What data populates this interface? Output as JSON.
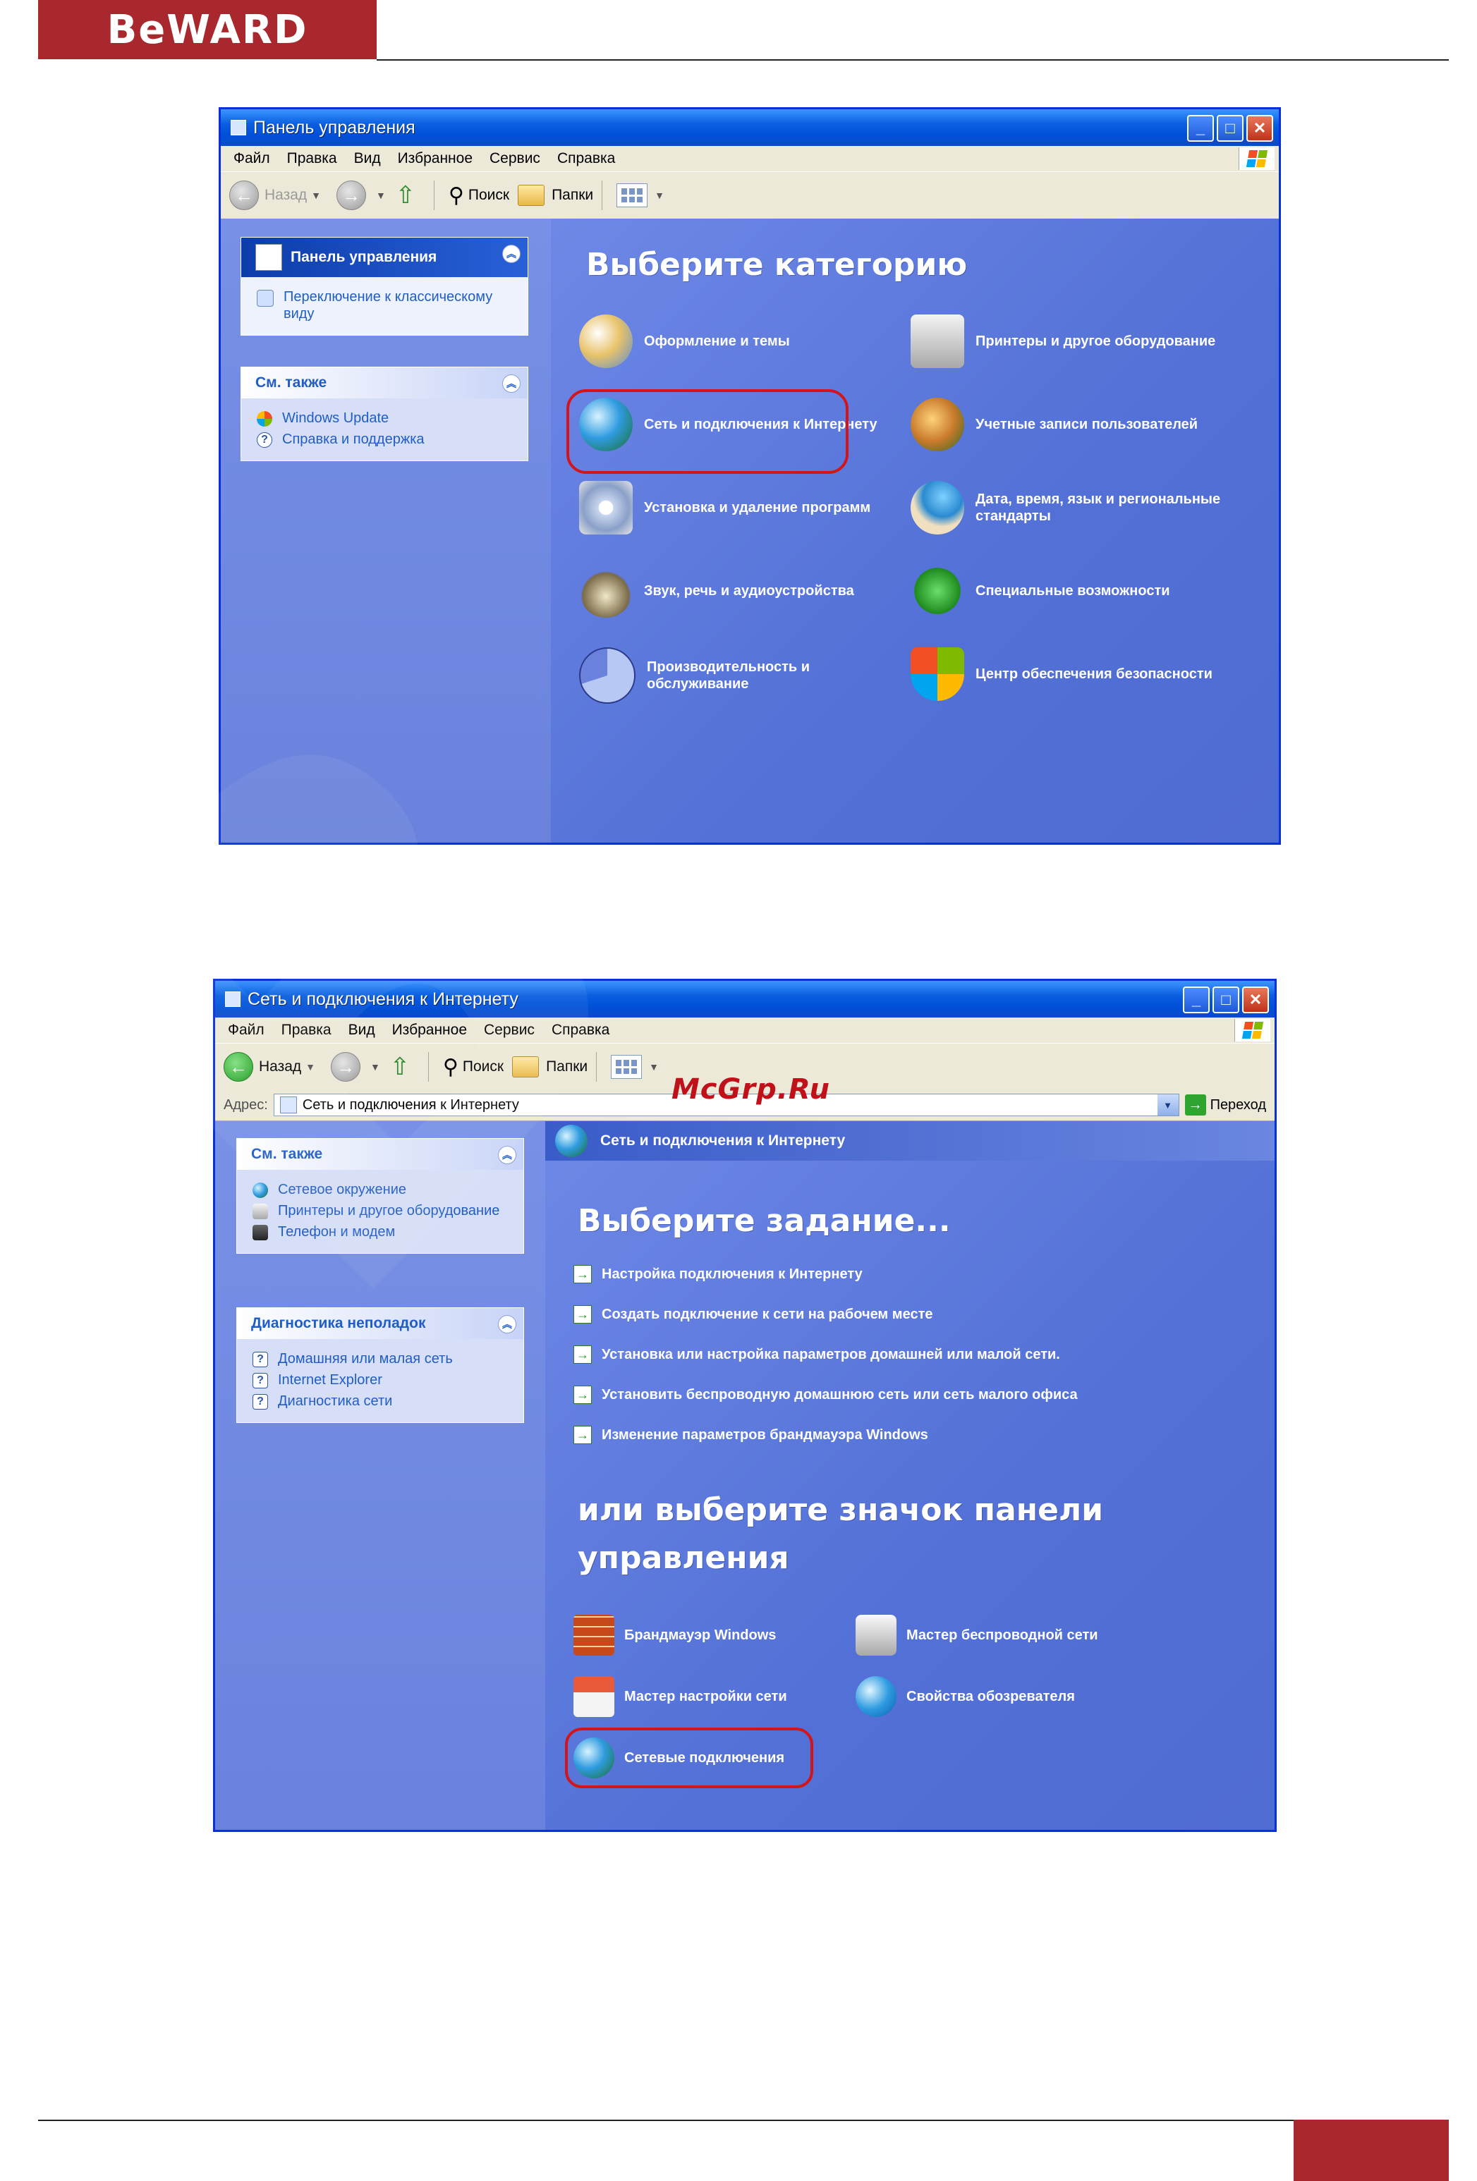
{
  "brand": {
    "logo": "BeWARD"
  },
  "watermark_site": "McGrp.Ru",
  "window1": {
    "title": "Панель управления",
    "menu": [
      "Файл",
      "Правка",
      "Вид",
      "Избранное",
      "Сервис",
      "Справка"
    ],
    "toolbar": {
      "back": "Назад",
      "search": "Поиск",
      "folders": "Папки"
    },
    "taskpane": {
      "main_title": "Панель управления",
      "switch_link": "Переключение к классическому виду",
      "see_also_title": "См. также",
      "see_also": [
        "Windows Update",
        "Справка и поддержка"
      ]
    },
    "heading": "Выберите категорию",
    "categories": [
      {
        "label": "Оформление и темы",
        "icon": "appearance-icon"
      },
      {
        "label": "Принтеры и другое оборудование",
        "icon": "printer-icon"
      },
      {
        "label": "Сеть и подключения к Интернету",
        "icon": "network-globe-icon"
      },
      {
        "label": "Учетные записи пользователей",
        "icon": "users-icon"
      },
      {
        "label": "Установка и удаление программ",
        "icon": "add-remove-programs-icon"
      },
      {
        "label": "Дата, время, язык и региональные стандарты",
        "icon": "date-time-globe-icon"
      },
      {
        "label": "Звук, речь и аудиоустройства",
        "icon": "sound-icon"
      },
      {
        "label": "Специальные возможности",
        "icon": "accessibility-icon"
      },
      {
        "label": "Производительность и обслуживание",
        "icon": "performance-icon"
      },
      {
        "label": "Центр обеспечения безопасности",
        "icon": "security-shield-icon"
      }
    ]
  },
  "window2": {
    "title": "Сеть и подключения к Интернету",
    "menu": [
      "Файл",
      "Правка",
      "Вид",
      "Избранное",
      "Сервис",
      "Справка"
    ],
    "toolbar": {
      "back": "Назад",
      "search": "Поиск",
      "folders": "Папки"
    },
    "address": {
      "label": "Адрес:",
      "value": "Сеть и подключения к Интернету",
      "go": "Переход"
    },
    "banner": "Сеть и подключения к Интернету",
    "taskpane": {
      "see_also_title": "См. также",
      "see_also": [
        "Сетевое окружение",
        "Принтеры и другое оборудование",
        "Телефон и модем"
      ],
      "troubleshoot_title": "Диагностика неполадок",
      "troubleshoot": [
        "Домашняя или малая сеть",
        "Internet Explorer",
        "Диагностика сети"
      ]
    },
    "heading_task": "Выберите задание...",
    "tasks": [
      "Настройка подключения к Интернету",
      "Создать подключение к сети на рабочем месте",
      "Установка или настройка параметров домашней или малой сети.",
      "Установить беспроводную домашнюю сеть или сеть малого офиса",
      "Изменение параметров брандмауэра Windows"
    ],
    "heading_icon_line1": "или выберите значок панели",
    "heading_icon_line2": "управления",
    "icons": [
      {
        "label": "Брандмауэр Windows",
        "icon": "firewall-icon"
      },
      {
        "label": "Мастер беспроводной сети",
        "icon": "wireless-icon"
      },
      {
        "label": "Мастер настройки сети",
        "icon": "network-setup-icon"
      },
      {
        "label": "Свойства обозревателя",
        "icon": "ie-options-icon"
      },
      {
        "label": "Сетевые подключения",
        "icon": "network-connections-icon"
      }
    ]
  },
  "colors": {
    "brand": "#a8282d",
    "highlight": "#d3151b",
    "xp_blue": "#0a5fe0"
  }
}
